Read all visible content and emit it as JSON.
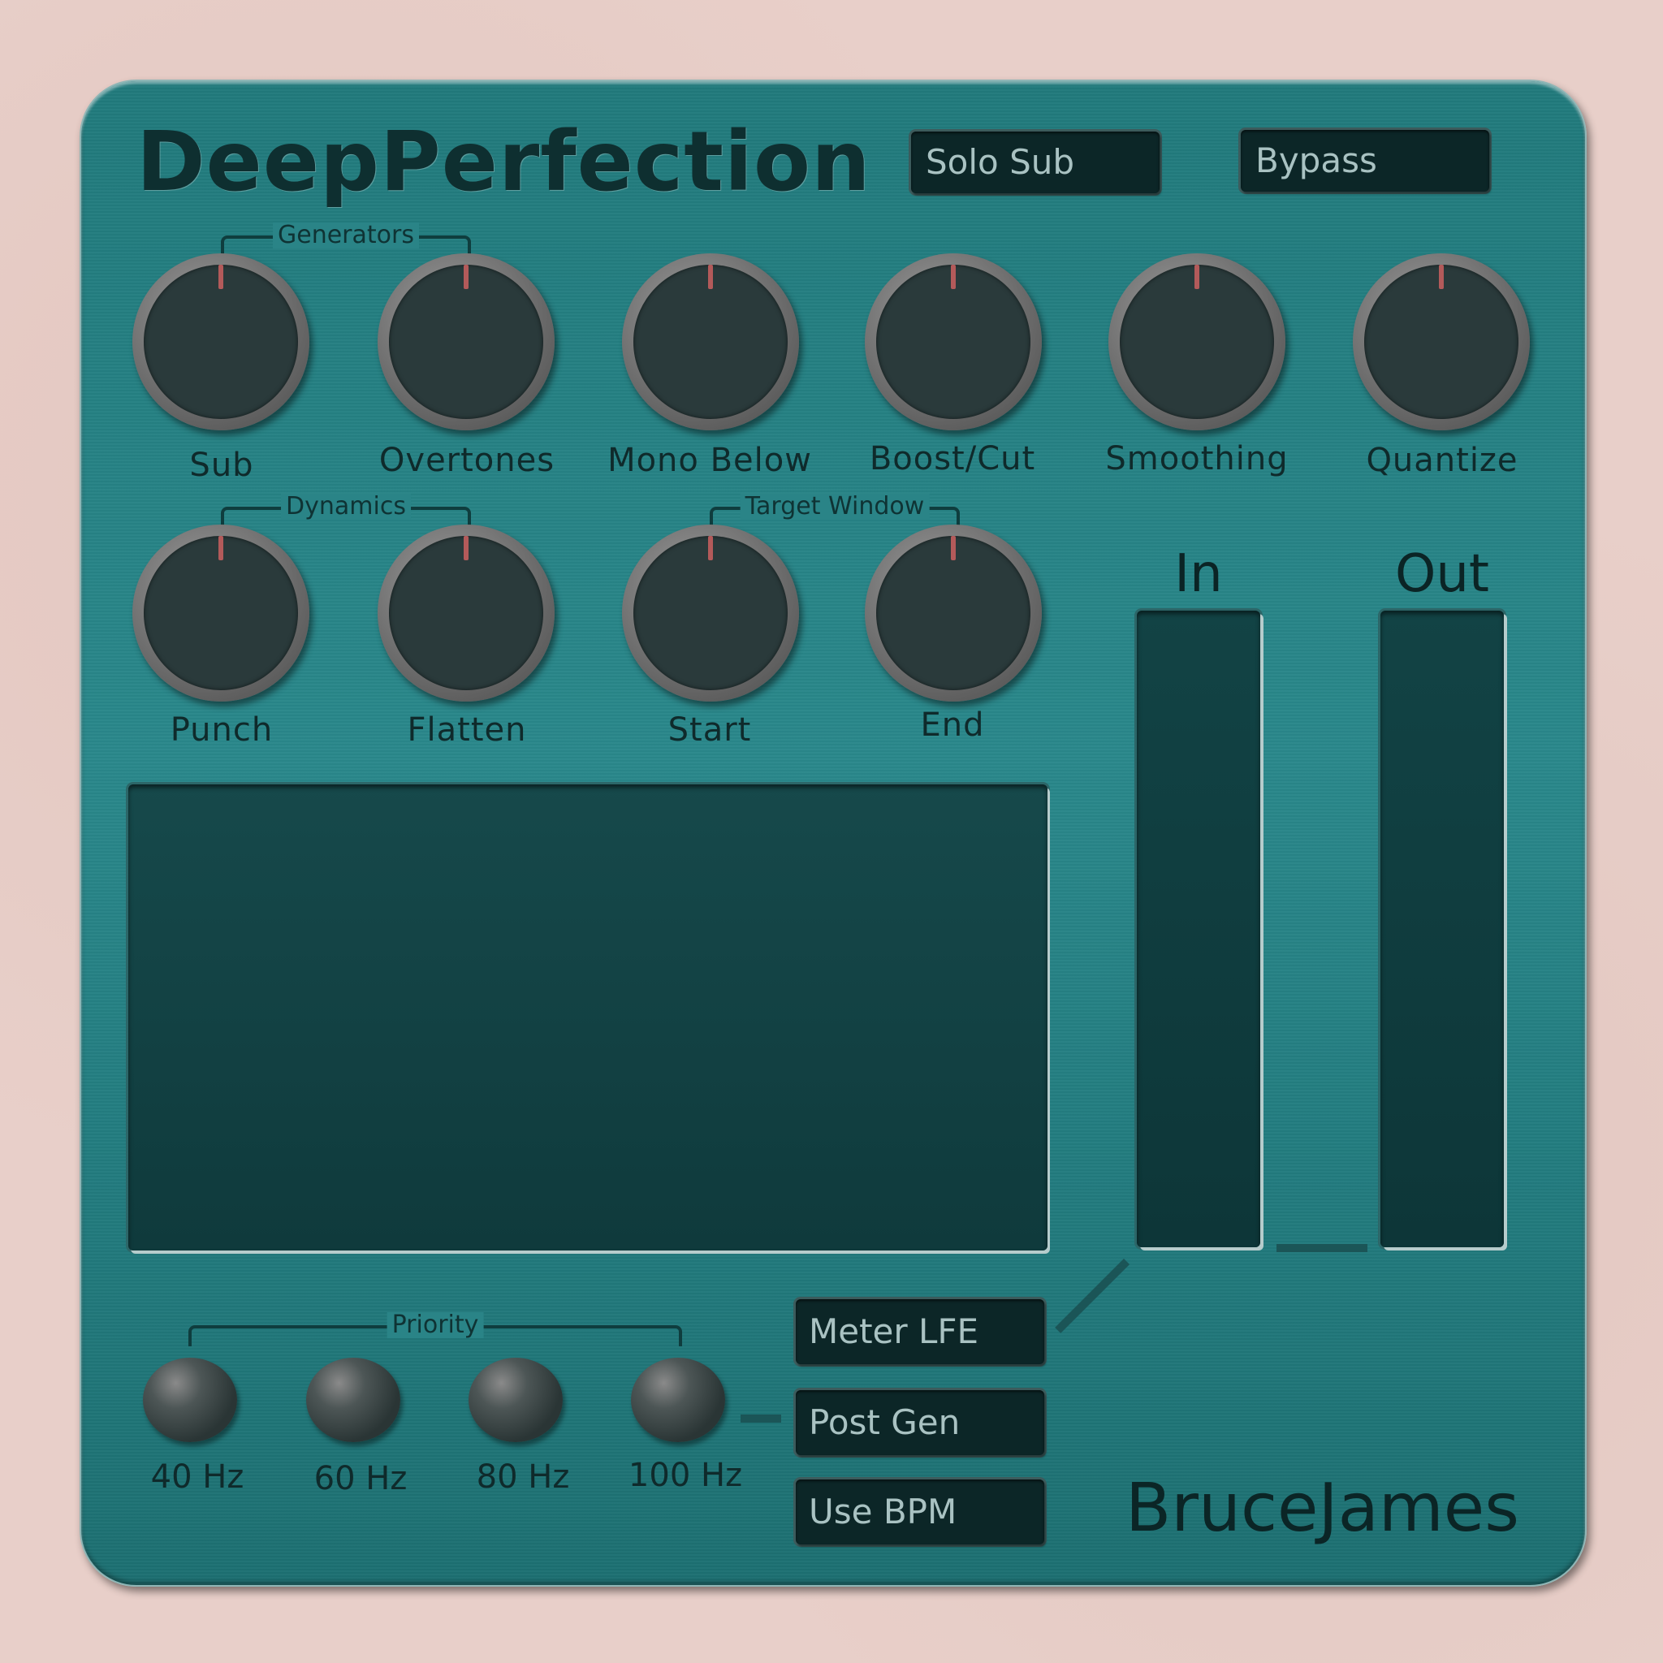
{
  "app": {
    "title": "DeepPerfection",
    "brand": "BruceJames"
  },
  "toggles": {
    "solo_sub": "Solo Sub",
    "bypass": "Bypass"
  },
  "groups": {
    "generators": "Generators",
    "dynamics": "Dynamics",
    "target_window": "Target Window",
    "priority": "Priority"
  },
  "knobs": {
    "row1": [
      "Sub",
      "Overtones",
      "Mono Below",
      "Boost/Cut",
      "Smoothing",
      "Quantize"
    ],
    "row2": [
      "Punch",
      "Flatten",
      "Start",
      "End"
    ]
  },
  "meters": {
    "in": "In",
    "out": "Out"
  },
  "priority_options": [
    "40 Hz",
    "60 Hz",
    "80 Hz",
    "100 Hz"
  ],
  "options": {
    "meter_lfe": "Meter LFE",
    "post_gen": "Post Gen",
    "use_bpm": "Use BPM"
  },
  "colors": {
    "panel": "#23807f",
    "knob_indicator": "#b35a5a",
    "display": "#0f3a3c"
  }
}
